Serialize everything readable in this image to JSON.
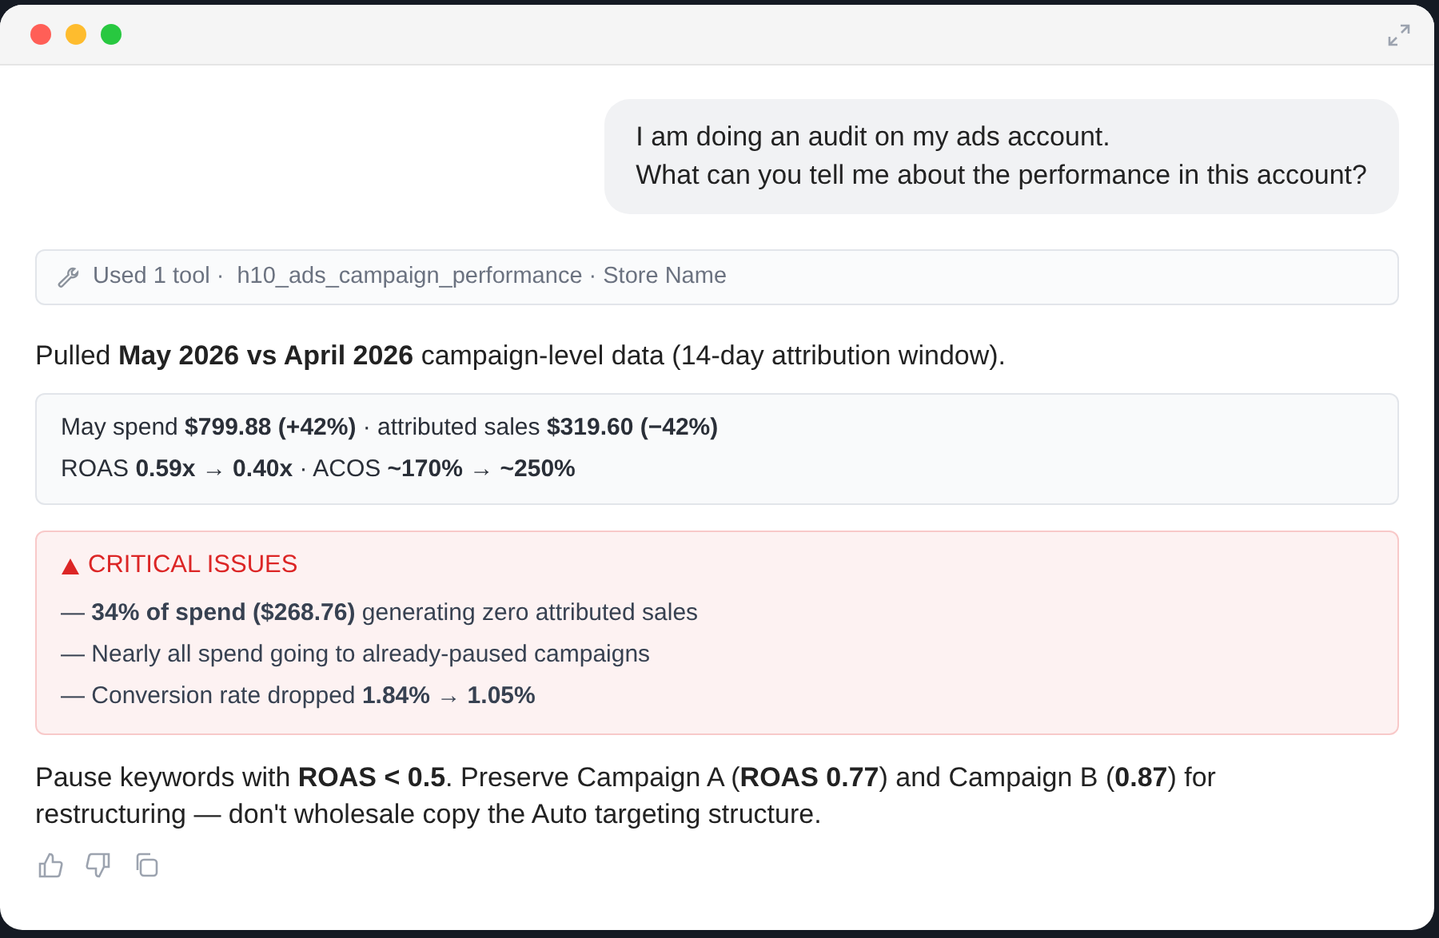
{
  "user_message": [
    "I am doing an audit on my ads account.",
    "What can you tell me about the performance in this account?"
  ],
  "tool_call": {
    "summary": "Used 1 tool ·",
    "detail": "h10_ads_campaign_performance · Store Name"
  },
  "intro": "Pulled **May 2026 vs April 2026** campaign-level data (14-day attribution window).",
  "stats": [
    "May spend **$799.88 (+42%)** · attributed sales **$319.60 (−42%)**",
    "ROAS **0.59x → 0.40x** · ACOS **~170% → ~250%**"
  ],
  "critical": {
    "title": "CRITICAL ISSUES",
    "items": [
      "— **34% of spend ($268.76)** generating zero attributed sales",
      "— Nearly all spend going to already-paused campaigns",
      "— Conversion rate dropped **1.84% → 1.05%**"
    ]
  },
  "recommendation": "Pause keywords with **ROAS < 0.5**. Preserve Campaign A (**ROAS 0.77**) and Campaign B (**0.87**) for restructuring — don't wholesale copy the Auto targeting structure."
}
